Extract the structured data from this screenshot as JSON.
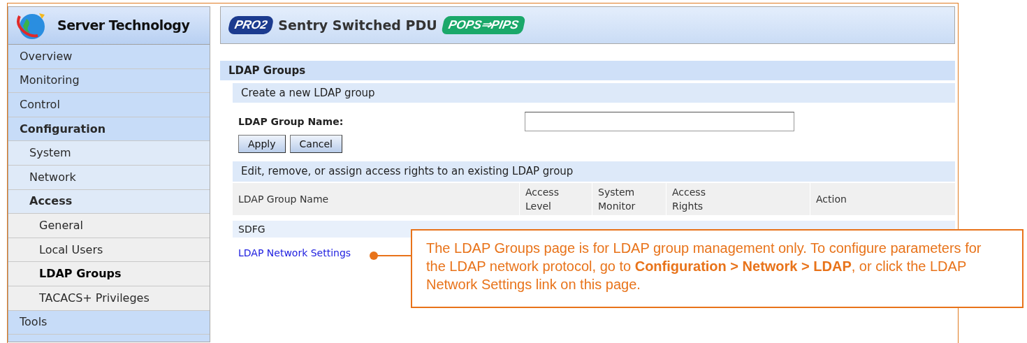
{
  "sidebar": {
    "brand": "Server Technology",
    "items": [
      {
        "label": "Overview",
        "selected": false
      },
      {
        "label": "Monitoring",
        "selected": false
      },
      {
        "label": "Control",
        "selected": false
      },
      {
        "label": "Configuration",
        "selected": false,
        "expanded": true,
        "children": [
          {
            "label": "System",
            "selected": false
          },
          {
            "label": "Network",
            "selected": false
          },
          {
            "label": "Access",
            "selected": false,
            "expanded": true,
            "children": [
              {
                "label": "General",
                "selected": false
              },
              {
                "label": "Local Users",
                "selected": false
              },
              {
                "label": "LDAP Groups",
                "selected": true
              },
              {
                "label": "TACACS+ Privileges",
                "selected": false
              }
            ]
          }
        ]
      },
      {
        "label": "Tools",
        "selected": false
      }
    ]
  },
  "header": {
    "badge_left": "PRO2",
    "title": "Sentry Switched PDU",
    "badge_right": "POPS⇒PIPS"
  },
  "page_title": "LDAP Groups",
  "create_section": {
    "title": "Create a new LDAP group",
    "field_label": "LDAP Group Name:",
    "buttons": [
      "Apply",
      "Cancel"
    ]
  },
  "edit_section": {
    "title": "Edit, remove, or assign access rights to an existing LDAP group",
    "columns": [
      "LDAP Group Name",
      "Access Level",
      "System Monitor",
      "Access Rights",
      "Action"
    ],
    "rows": [
      [
        "SDFG"
      ]
    ]
  },
  "link": "LDAP Network Settings",
  "callout": "The LDAP Groups page is for LDAP group management only. To configure parameters for the LDAP network protocol, go to **Configuration > Network > LDAP**, or click the LDAP Network Settings link on this page."
}
